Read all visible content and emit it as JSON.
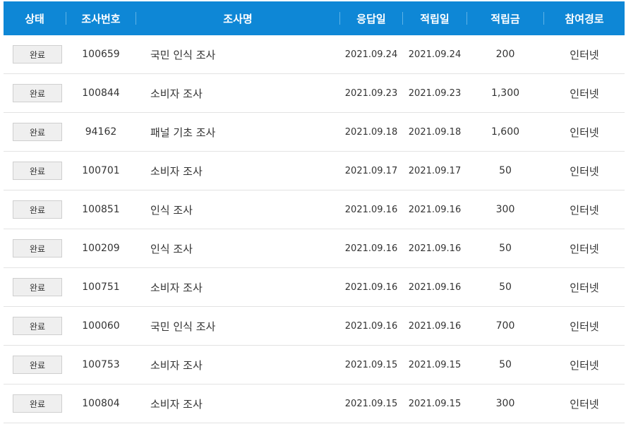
{
  "table": {
    "headers": [
      "상태",
      "조사번호",
      "조사명",
      "응답일",
      "적립일",
      "적립금",
      "참여경로"
    ],
    "rows": [
      {
        "status": "완료",
        "id": "100659",
        "name": "국민 인식 조사",
        "response_date": "2021.09.24",
        "accrual_date": "2021.09.24",
        "amount": "200",
        "route": "인터넷"
      },
      {
        "status": "완료",
        "id": "100844",
        "name": "소비자 조사",
        "response_date": "2021.09.23",
        "accrual_date": "2021.09.23",
        "amount": "1,300",
        "route": "인터넷"
      },
      {
        "status": "완료",
        "id": "94162",
        "name": "패널 기초 조사",
        "response_date": "2021.09.18",
        "accrual_date": "2021.09.18",
        "amount": "1,600",
        "route": "인터넷"
      },
      {
        "status": "완료",
        "id": "100701",
        "name": "소비자 조사",
        "response_date": "2021.09.17",
        "accrual_date": "2021.09.17",
        "amount": "50",
        "route": "인터넷"
      },
      {
        "status": "완료",
        "id": "100851",
        "name": "인식 조사",
        "response_date": "2021.09.16",
        "accrual_date": "2021.09.16",
        "amount": "300",
        "route": "인터넷"
      },
      {
        "status": "완료",
        "id": "100209",
        "name": "인식 조사",
        "response_date": "2021.09.16",
        "accrual_date": "2021.09.16",
        "amount": "50",
        "route": "인터넷"
      },
      {
        "status": "완료",
        "id": "100751",
        "name": "소비자 조사",
        "response_date": "2021.09.16",
        "accrual_date": "2021.09.16",
        "amount": "50",
        "route": "인터넷"
      },
      {
        "status": "완료",
        "id": "100060",
        "name": "국민 인식 조사",
        "response_date": "2021.09.16",
        "accrual_date": "2021.09.16",
        "amount": "700",
        "route": "인터넷"
      },
      {
        "status": "완료",
        "id": "100753",
        "name": "소비자 조사",
        "response_date": "2021.09.15",
        "accrual_date": "2021.09.15",
        "amount": "50",
        "route": "인터넷"
      },
      {
        "status": "완료",
        "id": "100804",
        "name": "소비자 조사",
        "response_date": "2021.09.15",
        "accrual_date": "2021.09.15",
        "amount": "300",
        "route": "인터넷"
      }
    ]
  },
  "colors": {
    "header_bg": "#0e87d6",
    "header_text": "#ffffff",
    "row_border": "#e3e3e3",
    "button_bg": "#efefef"
  }
}
